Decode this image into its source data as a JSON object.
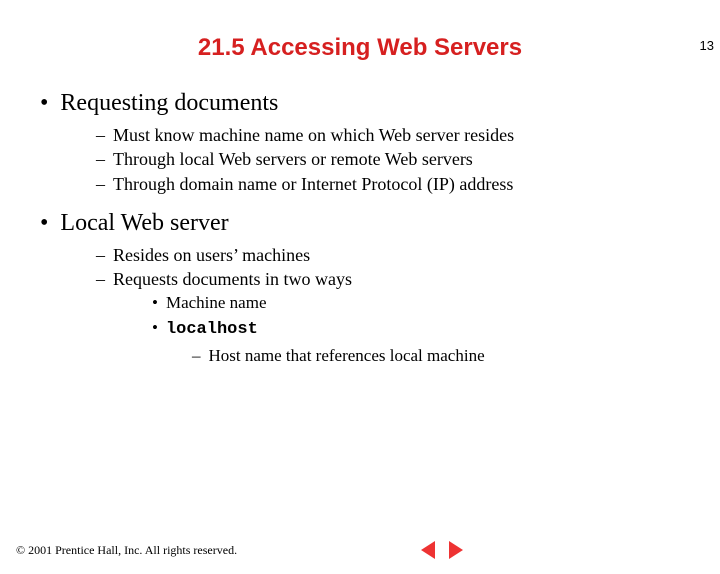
{
  "page_number": "13",
  "title": "21.5 Accessing Web Servers",
  "bullets": {
    "b1a": "Requesting documents",
    "b1a_s1": "Must know machine name on which Web server resides",
    "b1a_s2": "Through local Web servers or remote Web servers",
    "b1a_s3": "Through domain name or Internet Protocol (IP) address",
    "b1b": "Local Web server",
    "b1b_s1": "Resides on users’ machines",
    "b1b_s2": "Requests documents in two ways",
    "b1b_s2_a": "Machine name",
    "b1b_s2_b": "localhost",
    "b1b_s2_b_i": "Host name that references local machine"
  },
  "footer": {
    "copyright": "© 2001 Prentice Hall, Inc. All rights reserved."
  },
  "colors": {
    "title": "#d62020",
    "arrow": "#e33"
  }
}
